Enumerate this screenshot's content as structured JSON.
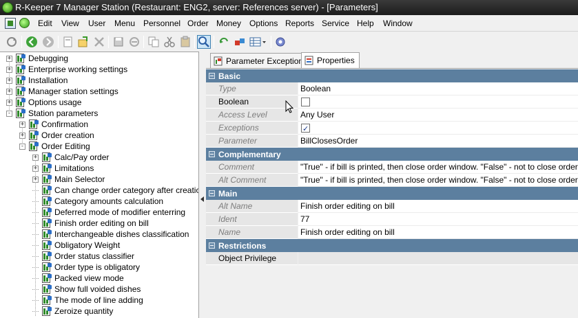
{
  "window": {
    "title": "R-Keeper 7 Manager Station (Restaurant: ENG2, server: References server) - [Parameters]"
  },
  "menu": [
    "Edit",
    "View",
    "User",
    "Menu",
    "Personnel",
    "Order",
    "Money",
    "Options",
    "Reports",
    "Service",
    "Help",
    "Window"
  ],
  "toolbar": [
    "refresh-icon",
    "back-icon",
    "forward-icon",
    "new-icon",
    "edit-icon",
    "delete-icon",
    "save-icon",
    "cancel-icon",
    "cut-icon",
    "paste-icon",
    "find-icon",
    "reload-icon",
    "link-icon",
    "grid-view-icon",
    "settings-gear-icon"
  ],
  "tree": {
    "items": [
      {
        "label": "Debugging",
        "level": 0,
        "expander": "+"
      },
      {
        "label": "Enterprise working settings",
        "level": 0,
        "expander": "+"
      },
      {
        "label": "Installation",
        "level": 0,
        "expander": "+"
      },
      {
        "label": "Manager station settings",
        "level": 0,
        "expander": "+"
      },
      {
        "label": "Options usage",
        "level": 0,
        "expander": "+"
      },
      {
        "label": "Station parameters",
        "level": 0,
        "expander": "-"
      },
      {
        "label": "Confirmation",
        "level": 1,
        "expander": "+"
      },
      {
        "label": "Order creation",
        "level": 1,
        "expander": "+"
      },
      {
        "label": "Order Editing",
        "level": 1,
        "expander": "-"
      },
      {
        "label": "Calc/Pay order",
        "level": 2,
        "expander": "+"
      },
      {
        "label": "Limitations",
        "level": 2,
        "expander": "+"
      },
      {
        "label": "Main Selector",
        "level": 2,
        "expander": "+"
      },
      {
        "label": "Can change order category after creation",
        "level": 2,
        "expander": ""
      },
      {
        "label": "Category amounts calculation",
        "level": 2,
        "expander": ""
      },
      {
        "label": "Deferred mode of modifier enterring",
        "level": 2,
        "expander": ""
      },
      {
        "label": "Finish order editing on bill",
        "level": 2,
        "expander": ""
      },
      {
        "label": "Interchangeable dishes classification",
        "level": 2,
        "expander": ""
      },
      {
        "label": "Obligatory Weight",
        "level": 2,
        "expander": ""
      },
      {
        "label": "Order status classifier",
        "level": 2,
        "expander": ""
      },
      {
        "label": "Order type is obligatory",
        "level": 2,
        "expander": ""
      },
      {
        "label": "Packed view mode",
        "level": 2,
        "expander": ""
      },
      {
        "label": "Show full voided dishes",
        "level": 2,
        "expander": ""
      },
      {
        "label": "The mode of line adding",
        "level": 2,
        "expander": ""
      },
      {
        "label": "Zeroize quantity",
        "level": 2,
        "expander": ""
      }
    ]
  },
  "tabs": [
    {
      "label": "Parameter Exceptions",
      "active": false
    },
    {
      "label": "Properties",
      "active": true
    }
  ],
  "properties": {
    "basic": {
      "title": "Basic",
      "type": {
        "name": "Type",
        "value": "Boolean"
      },
      "boolean": {
        "name": "Boolean",
        "checked": false
      },
      "access_level": {
        "name": "Access Level",
        "value": "Any User"
      },
      "exceptions": {
        "name": "Exceptions",
        "checked": true
      },
      "parameter": {
        "name": "Parameter",
        "value": "BillClosesOrder"
      }
    },
    "complementary": {
      "title": "Complementary",
      "comment": {
        "name": "Comment",
        "value": "\"True\" - if bill is printed, then close order window. \"False\" - not to close order window"
      },
      "alt_comment": {
        "name": "Alt Comment",
        "value": "\"True\" - if bill is printed, then close order window. \"False\" - not to close order window"
      }
    },
    "main": {
      "title": "Main",
      "alt_name": {
        "name": "Alt Name",
        "value": "Finish order editing on bill"
      },
      "ident": {
        "name": "Ident",
        "value": "77"
      },
      "name": {
        "name": "Name",
        "value": "Finish order editing on bill"
      }
    },
    "restrictions": {
      "title": "Restrictions",
      "object_privilege": {
        "name": "Object Privilege",
        "value": ""
      }
    }
  }
}
